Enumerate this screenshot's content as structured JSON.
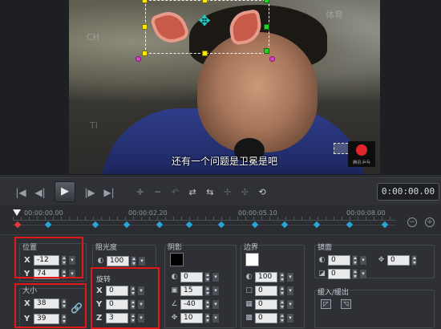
{
  "video": {
    "subtitle": "还有一个问题是卫冕是吧",
    "logo_text": "腾讯·乒乓",
    "watermarks": [
      "CH",
      "TI",
      "体育"
    ]
  },
  "playback": {
    "buttons": [
      "go-start",
      "prev-frame",
      "play",
      "next-frame",
      "go-end"
    ],
    "timecode": "0:00:00.00"
  },
  "timeline": {
    "ticks": [
      "00:00:00.00",
      "00:00:02.20",
      "00:00:05.10",
      "00:00:08.00"
    ],
    "keyframes": 12
  },
  "panel": {
    "position": {
      "title": "位置",
      "x_label": "X",
      "x": "-12",
      "y_label": "Y",
      "y": "74"
    },
    "size": {
      "title": "大小",
      "x_label": "X",
      "x": "38",
      "y_label": "Y",
      "y": "39"
    },
    "opacity": {
      "title": "阻光度",
      "value": "100"
    },
    "rotation": {
      "title": "旋转",
      "x_label": "X",
      "x": "0",
      "y_label": "Y",
      "y": "0",
      "z_label": "Z",
      "z": "3"
    },
    "shadow": {
      "title": "阴影",
      "opacity": "0",
      "size": "15",
      "angle": "-40",
      "distance": "10",
      "color": "#000000"
    },
    "border": {
      "title": "边界",
      "opacity": "100",
      "size": "0",
      "blur": "0",
      "offset": "0",
      "color": "#ffffff"
    },
    "mirror": {
      "title": "镜面",
      "opacity": "0",
      "offset": "0",
      "blur": "0"
    },
    "fade": {
      "title": "缓入/缓出"
    }
  }
}
